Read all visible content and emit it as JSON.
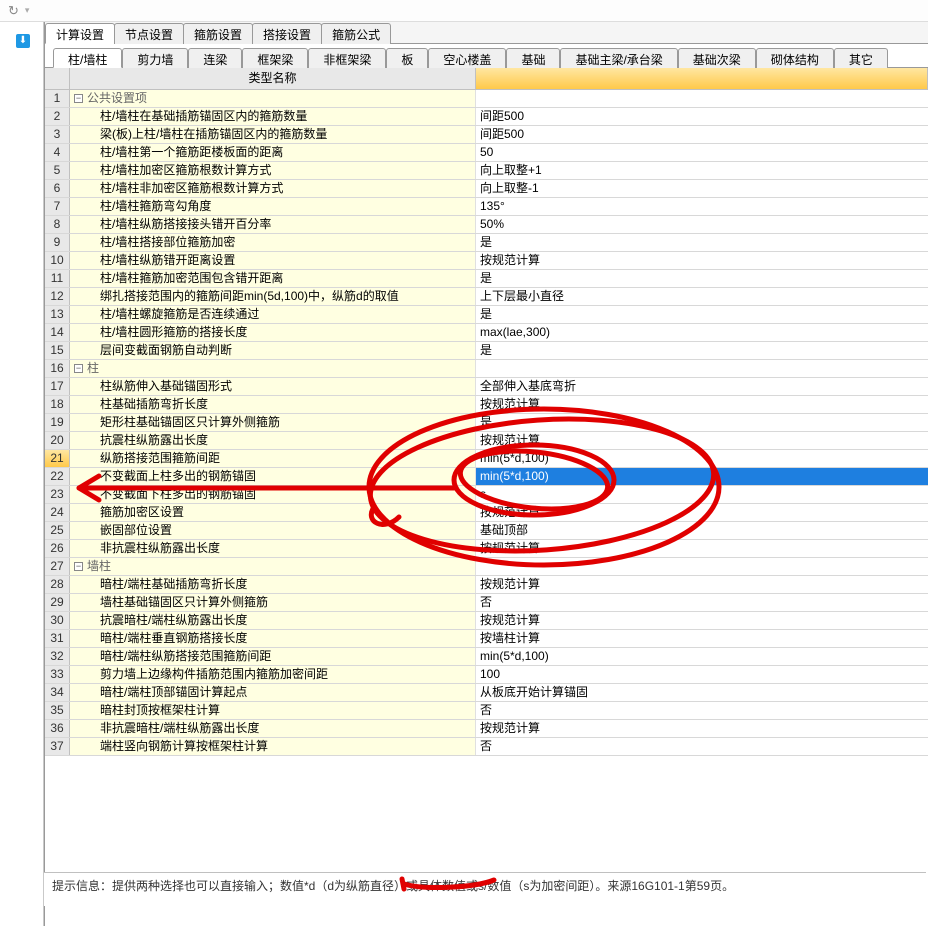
{
  "topbar": {
    "refresh_glyph": "↻",
    "dropdown_glyph": "▾"
  },
  "dock": {
    "pin_glyph": "⬇"
  },
  "tabs": [
    {
      "label": "计算设置",
      "active": true
    },
    {
      "label": "节点设置",
      "active": false
    },
    {
      "label": "箍筋设置",
      "active": false
    },
    {
      "label": "搭接设置",
      "active": false
    },
    {
      "label": "箍筋公式",
      "active": false
    }
  ],
  "subtabs": [
    {
      "label": "柱/墙柱",
      "active": true
    },
    {
      "label": "剪力墙",
      "active": false
    },
    {
      "label": "连梁",
      "active": false
    },
    {
      "label": "框架梁",
      "active": false
    },
    {
      "label": "非框架梁",
      "active": false
    },
    {
      "label": "板",
      "active": false
    },
    {
      "label": "空心楼盖",
      "active": false
    },
    {
      "label": "基础",
      "active": false
    },
    {
      "label": "基础主梁/承台梁",
      "active": false
    },
    {
      "label": "基础次梁",
      "active": false
    },
    {
      "label": "砌体结构",
      "active": false
    },
    {
      "label": "其它",
      "active": false
    }
  ],
  "columns": {
    "c1": "类型名称",
    "c2": ""
  },
  "rows": [
    {
      "n": 1,
      "group": true,
      "label": "公共设置项",
      "value": ""
    },
    {
      "n": 2,
      "indent": 1,
      "label": "柱/墙柱在基础插筋锚固区内的箍筋数量",
      "value": "间距500"
    },
    {
      "n": 3,
      "indent": 1,
      "label": "梁(板)上柱/墙柱在插筋锚固区内的箍筋数量",
      "value": "间距500"
    },
    {
      "n": 4,
      "indent": 1,
      "label": "柱/墙柱第一个箍筋距楼板面的距离",
      "value": "50"
    },
    {
      "n": 5,
      "indent": 1,
      "label": "柱/墙柱加密区箍筋根数计算方式",
      "value": "向上取整+1"
    },
    {
      "n": 6,
      "indent": 1,
      "label": "柱/墙柱非加密区箍筋根数计算方式",
      "value": "向上取整-1"
    },
    {
      "n": 7,
      "indent": 1,
      "label": "柱/墙柱箍筋弯勾角度",
      "value": "135°"
    },
    {
      "n": 8,
      "indent": 1,
      "label": "柱/墙柱纵筋搭接接头错开百分率",
      "value": "50%"
    },
    {
      "n": 9,
      "indent": 1,
      "label": "柱/墙柱搭接部位箍筋加密",
      "value": "是"
    },
    {
      "n": 10,
      "indent": 1,
      "label": "柱/墙柱纵筋错开距离设置",
      "value": "按规范计算"
    },
    {
      "n": 11,
      "indent": 1,
      "label": "柱/墙柱箍筋加密范围包含错开距离",
      "value": "是"
    },
    {
      "n": 12,
      "indent": 1,
      "label": "绑扎搭接范围内的箍筋间距min(5d,100)中，纵筋d的取值",
      "value": "上下层最小直径"
    },
    {
      "n": 13,
      "indent": 1,
      "label": "柱/墙柱螺旋箍筋是否连续通过",
      "value": "是"
    },
    {
      "n": 14,
      "indent": 1,
      "label": "柱/墙柱圆形箍筋的搭接长度",
      "value": "max(lae,300)"
    },
    {
      "n": 15,
      "indent": 1,
      "label": "层间变截面钢筋自动判断",
      "value": "是"
    },
    {
      "n": 16,
      "group": true,
      "label": "柱",
      "value": ""
    },
    {
      "n": 17,
      "indent": 1,
      "label": "柱纵筋伸入基础锚固形式",
      "value": "全部伸入基底弯折"
    },
    {
      "n": 18,
      "indent": 1,
      "label": "柱基础插筋弯折长度",
      "value": "按规范计算"
    },
    {
      "n": 19,
      "indent": 1,
      "label": "矩形柱基础锚固区只计算外侧箍筋",
      "value": "是"
    },
    {
      "n": 20,
      "indent": 1,
      "label": "抗震柱纵筋露出长度",
      "value": "按规范计算"
    },
    {
      "n": 21,
      "indent": 1,
      "hl": true,
      "label": "纵筋搭接范围箍筋间距",
      "value": "min(5*d,100)"
    },
    {
      "n": 22,
      "indent": 1,
      "sel": true,
      "label": "不变截面上柱多出的钢筋锚固",
      "value": "min(5*d,100)"
    },
    {
      "n": 23,
      "indent": 1,
      "label": "不变截面下柱多出的钢筋锚固",
      "value": "s"
    },
    {
      "n": 24,
      "indent": 1,
      "label": "箍筋加密区设置",
      "value": "按规范计算"
    },
    {
      "n": 25,
      "indent": 1,
      "label": "嵌固部位设置",
      "value": "基础顶部"
    },
    {
      "n": 26,
      "indent": 1,
      "label": "非抗震柱纵筋露出长度",
      "value": "按规范计算"
    },
    {
      "n": 27,
      "group": true,
      "label": "墙柱",
      "value": ""
    },
    {
      "n": 28,
      "indent": 1,
      "label": "暗柱/端柱基础插筋弯折长度",
      "value": "按规范计算"
    },
    {
      "n": 29,
      "indent": 1,
      "label": "墙柱基础锚固区只计算外侧箍筋",
      "value": "否"
    },
    {
      "n": 30,
      "indent": 1,
      "label": "抗震暗柱/端柱纵筋露出长度",
      "value": "按规范计算"
    },
    {
      "n": 31,
      "indent": 1,
      "label": "暗柱/端柱垂直钢筋搭接长度",
      "value": "按墙柱计算"
    },
    {
      "n": 32,
      "indent": 1,
      "label": "暗柱/端柱纵筋搭接范围箍筋间距",
      "value": "min(5*d,100)"
    },
    {
      "n": 33,
      "indent": 1,
      "label": "剪力墙上边缘构件插筋范围内箍筋加密间距",
      "value": "100"
    },
    {
      "n": 34,
      "indent": 1,
      "label": "暗柱/端柱顶部锚固计算起点",
      "value": "从板底开始计算锚固"
    },
    {
      "n": 35,
      "indent": 1,
      "label": "暗柱封顶按框架柱计算",
      "value": "否"
    },
    {
      "n": 36,
      "indent": 1,
      "label": "非抗震暗柱/端柱纵筋露出长度",
      "value": "按规范计算"
    },
    {
      "n": 37,
      "indent": 1,
      "label": "端柱竖向钢筋计算按框架柱计算",
      "value": "否"
    }
  ],
  "footer": "提示信息：提供两种选择也可以直接输入；数值*d（d为纵筋直径）或具体数值或s/数值（s为加密间距）。来源16G101-1第59页。"
}
